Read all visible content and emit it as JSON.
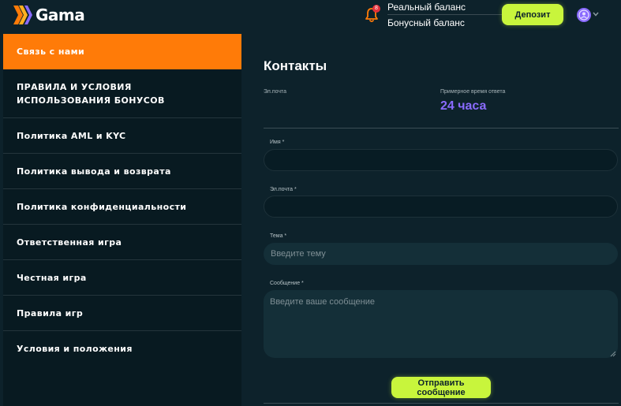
{
  "header": {
    "logo_text": "Gama",
    "notification_count": "8",
    "real_balance_label": "Реальный баланс",
    "bonus_balance_label": "Бонусный баланс",
    "deposit_label": "Депозит"
  },
  "sidebar": {
    "items": [
      {
        "label": "Связь с нами",
        "active": true
      },
      {
        "label": "ПРАВИЛА И УСЛОВИЯ ИСПОЛЬЗОВАНИЯ БОНУСОВ",
        "active": false
      },
      {
        "label": "Политика AML и KYC",
        "active": false
      },
      {
        "label": "Политика вывода и возврата",
        "active": false
      },
      {
        "label": "Политика конфиденциальности",
        "active": false
      },
      {
        "label": "Ответственная игра",
        "active": false
      },
      {
        "label": "Честная игра",
        "active": false
      },
      {
        "label": "Правила игр",
        "active": false
      },
      {
        "label": "Условия и положения",
        "active": false
      }
    ]
  },
  "contacts": {
    "title": "Контакты",
    "email_label": "Эл.почта",
    "email_value": "",
    "response_time_label": "Примерное время ответа",
    "response_time_value": "24 часа"
  },
  "form": {
    "name_label": "Имя *",
    "name_value": "",
    "email_label": "Эл.почта *",
    "email_value": "",
    "subject_label": "Тема *",
    "subject_placeholder": "Введите тему",
    "message_label": "Сообщение *",
    "message_placeholder": "Введите ваше сообщение",
    "submit_label": "Отправить сообщение"
  },
  "colors": {
    "background": "#0d222b",
    "sidebar": "#081a21",
    "active_item": "#ff7b08",
    "accent_button": "#c8f53c",
    "response_time": "#8a6bff",
    "badge": "#e5303a"
  }
}
